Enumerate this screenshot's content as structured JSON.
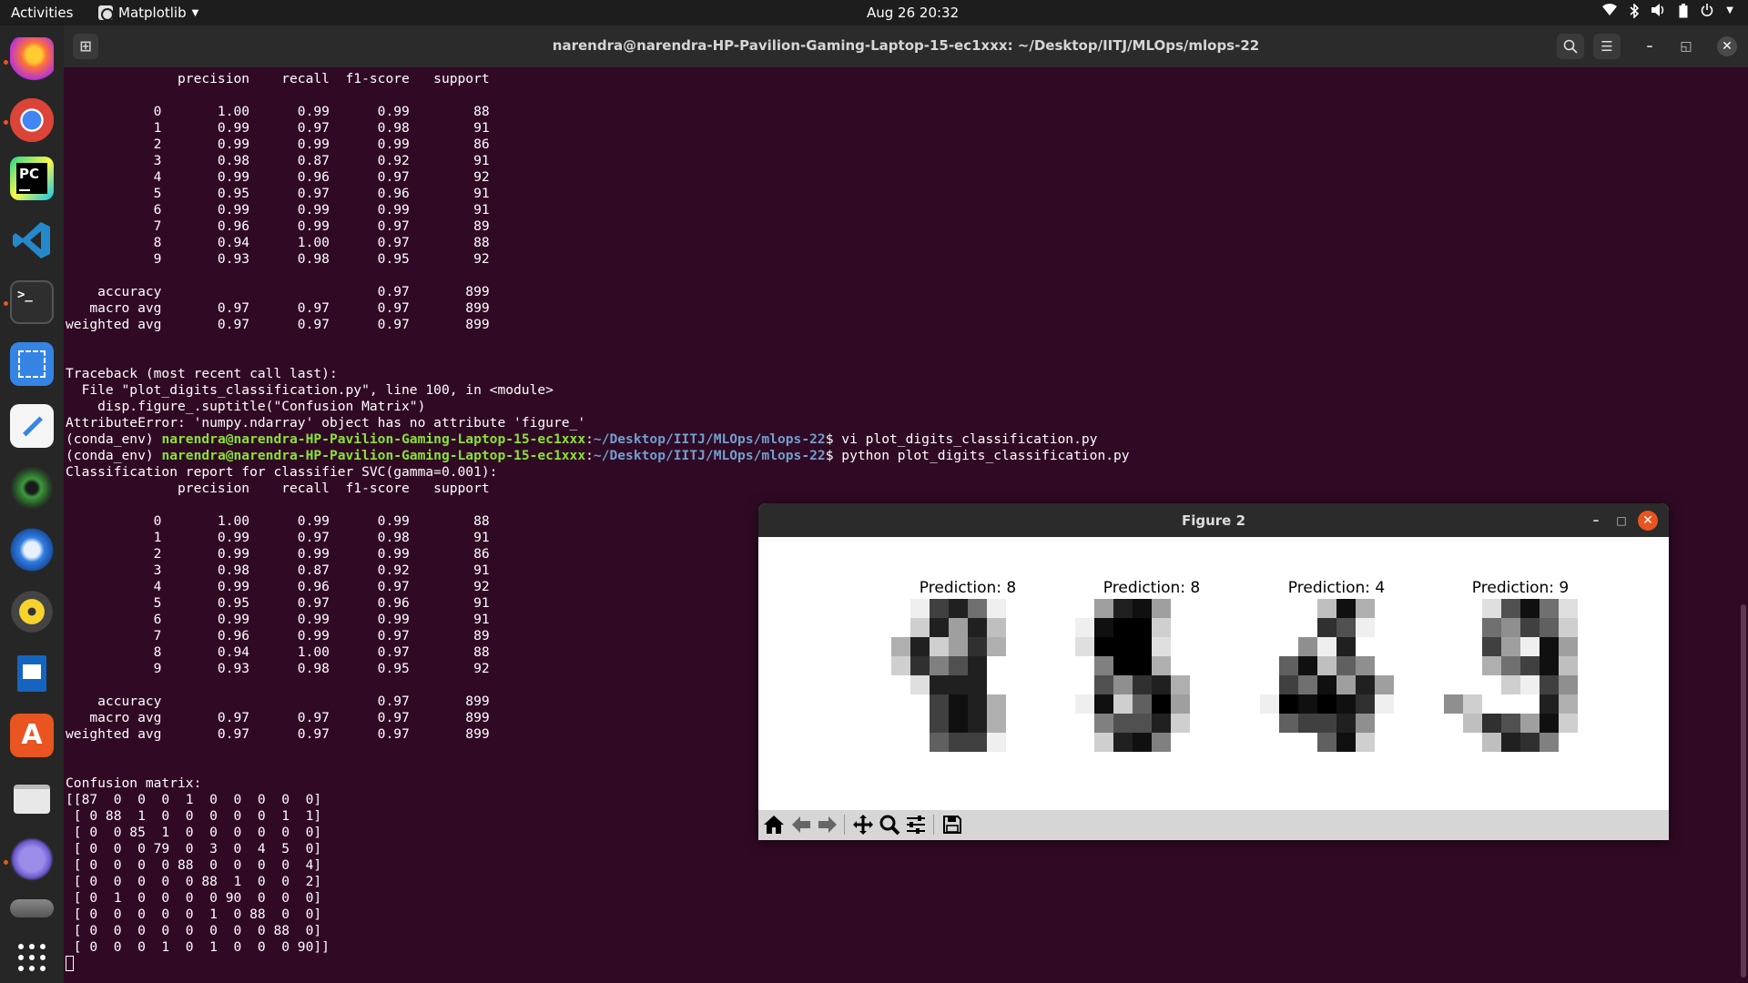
{
  "topbar": {
    "activities": "Activities",
    "app_name": "Matplotlib",
    "clock": "Aug 26  20:32",
    "tray_icons": [
      "wifi-icon",
      "bluetooth-icon",
      "volume-icon",
      "battery-icon",
      "power-icon"
    ]
  },
  "dock": {
    "items": [
      {
        "name": "firefox",
        "color": "#e66000"
      },
      {
        "name": "chrome",
        "color": "#4285f4"
      },
      {
        "name": "pycharm",
        "color": "#000000"
      },
      {
        "name": "vscode",
        "color": "#0078d7"
      },
      {
        "name": "terminal",
        "color": "#2e2e2e"
      },
      {
        "name": "screenshot",
        "color": "#3584e4"
      },
      {
        "name": "text-editor",
        "color": "#f5f5f5"
      },
      {
        "name": "webcam",
        "color": "#2a4a2a"
      },
      {
        "name": "thunderbird",
        "color": "#1a73e8"
      },
      {
        "name": "rhythmbox",
        "color": "#f6d32d"
      },
      {
        "name": "libreoffice-writer",
        "color": "#1565c0"
      },
      {
        "name": "software",
        "color": "#e95420"
      },
      {
        "name": "files",
        "color": "#cfcfcf"
      },
      {
        "name": "network",
        "color": "#7764d8"
      },
      {
        "name": "disk-usage",
        "color": "#555555"
      },
      {
        "name": "show-apps",
        "color": "#262626"
      }
    ]
  },
  "terminal": {
    "title": "narendra@narendra-HP-Pavilion-Gaming-Laptop-15-ec1xxx: ~/Desktop/IITJ/MLOps/mlops-22",
    "prompt_prefix": "(conda_env) ",
    "prompt_user": "narendra@narendra-HP-Pavilion-Gaming-Laptop-15-ec1xxx",
    "prompt_path": "~/Desktop/IITJ/MLOps/mlops-22",
    "lines_1": [
      "              precision    recall  f1-score   support",
      "",
      "           0       1.00      0.99      0.99        88",
      "           1       0.99      0.97      0.98        91",
      "           2       0.99      0.99      0.99        86",
      "           3       0.98      0.87      0.92        91",
      "           4       0.99      0.96      0.97        92",
      "           5       0.95      0.97      0.96        91",
      "           6       0.99      0.99      0.99        91",
      "           7       0.96      0.99      0.97        89",
      "           8       0.94      1.00      0.97        88",
      "           9       0.93      0.98      0.95        92",
      "",
      "    accuracy                           0.97       899",
      "   macro avg       0.97      0.97      0.97       899",
      "weighted avg       0.97      0.97      0.97       899",
      "",
      "",
      "Traceback (most recent call last):",
      "  File \"plot_digits_classification.py\", line 100, in <module>",
      "    disp.figure_.suptitle(\"Confusion Matrix\")",
      "AttributeError: 'numpy.ndarray' object has no attribute 'figure_'"
    ],
    "cmd_1": "$ vi plot_digits_classification.py",
    "cmd_2": "$ python plot_digits_classification.py",
    "lines_2": [
      "Classification report for classifier SVC(gamma=0.001):",
      "              precision    recall  f1-score   support",
      "",
      "           0       1.00      0.99      0.99        88",
      "           1       0.99      0.97      0.98        91",
      "           2       0.99      0.99      0.99        86",
      "           3       0.98      0.87      0.92        91",
      "           4       0.99      0.96      0.97        92",
      "           5       0.95      0.97      0.96        91",
      "           6       0.99      0.99      0.99        91",
      "           7       0.96      0.99      0.97        89",
      "           8       0.94      1.00      0.97        88",
      "           9       0.93      0.98      0.95        92",
      "",
      "    accuracy                           0.97       899",
      "   macro avg       0.97      0.97      0.97       899",
      "weighted avg       0.97      0.97      0.97       899",
      "",
      "",
      "Confusion matrix:",
      "[[87  0  0  0  1  0  0  0  0  0]",
      " [ 0 88  1  0  0  0  0  0  1  1]",
      " [ 0  0 85  1  0  0  0  0  0  0]",
      " [ 0  0  0 79  0  3  0  4  5  0]",
      " [ 0  0  0  0 88  0  0  0  0  4]",
      " [ 0  0  0  0  0 88  1  0  0  2]",
      " [ 0  1  0  0  0  0 90  0  0  0]",
      " [ 0  0  0  0  0  1  0 88  0  0]",
      " [ 0  0  0  0  0  0  0  0 88  0]",
      " [ 0  0  0  1  0  1  0  0  0 90]]"
    ]
  },
  "figure": {
    "title": "Figure 2",
    "panels": [
      {
        "label": "Prediction: 8",
        "pixels": [
          [
            0,
            1,
            12,
            14,
            9,
            1,
            0,
            0
          ],
          [
            0,
            3,
            14,
            6,
            14,
            4,
            0,
            0
          ],
          [
            5,
            14,
            3,
            6,
            13,
            5,
            0,
            0
          ],
          [
            3,
            13,
            8,
            11,
            14,
            0,
            0,
            0
          ],
          [
            0,
            2,
            14,
            14,
            14,
            0,
            0,
            0
          ],
          [
            0,
            0,
            12,
            15,
            14,
            5,
            0,
            0
          ],
          [
            0,
            0,
            12,
            15,
            14,
            5,
            0,
            0
          ],
          [
            0,
            0,
            10,
            12,
            12,
            1,
            0,
            0
          ]
        ]
      },
      {
        "label": "Prediction: 8",
        "pixels": [
          [
            0,
            6,
            14,
            15,
            6,
            0,
            0,
            0
          ],
          [
            1,
            15,
            16,
            16,
            3,
            0,
            0,
            0
          ],
          [
            2,
            16,
            16,
            16,
            2,
            0,
            0,
            0
          ],
          [
            0,
            8,
            16,
            16,
            5,
            0,
            0,
            0
          ],
          [
            0,
            11,
            7,
            13,
            14,
            5,
            0,
            0
          ],
          [
            1,
            15,
            3,
            10,
            16,
            6,
            0,
            0
          ],
          [
            0,
            8,
            11,
            11,
            14,
            3,
            0,
            0
          ],
          [
            0,
            3,
            14,
            15,
            8,
            0,
            0,
            0
          ]
        ]
      },
      {
        "label": "Prediction: 4",
        "pixels": [
          [
            0,
            0,
            0,
            4,
            15,
            5,
            0,
            0
          ],
          [
            0,
            0,
            0,
            13,
            11,
            1,
            0,
            0
          ],
          [
            0,
            0,
            7,
            1,
            14,
            0,
            0,
            0
          ],
          [
            0,
            10,
            15,
            4,
            10,
            7,
            0,
            0
          ],
          [
            0,
            12,
            9,
            15,
            6,
            14,
            6,
            0
          ],
          [
            1,
            16,
            15,
            16,
            15,
            13,
            1,
            0
          ],
          [
            0,
            10,
            12,
            12,
            14,
            7,
            0,
            0
          ],
          [
            0,
            0,
            0,
            10,
            15,
            3,
            0,
            0
          ]
        ]
      },
      {
        "label": "Prediction: 9",
        "pixels": [
          [
            0,
            0,
            2,
            11,
            15,
            9,
            2,
            0
          ],
          [
            0,
            0,
            9,
            7,
            12,
            10,
            3,
            0
          ],
          [
            0,
            0,
            12,
            6,
            1,
            15,
            6,
            0
          ],
          [
            0,
            0,
            5,
            9,
            12,
            15,
            4,
            0
          ],
          [
            0,
            0,
            0,
            3,
            1,
            12,
            7,
            0
          ],
          [
            7,
            3,
            0,
            0,
            0,
            14,
            5,
            0
          ],
          [
            0,
            4,
            13,
            11,
            6,
            15,
            3,
            0
          ],
          [
            0,
            0,
            4,
            14,
            13,
            8,
            0,
            0
          ]
        ]
      }
    ],
    "toolbar": [
      "home-icon",
      "back-icon",
      "forward-icon",
      "pan-icon",
      "zoom-icon",
      "configure-subplots-icon",
      "save-icon"
    ]
  }
}
